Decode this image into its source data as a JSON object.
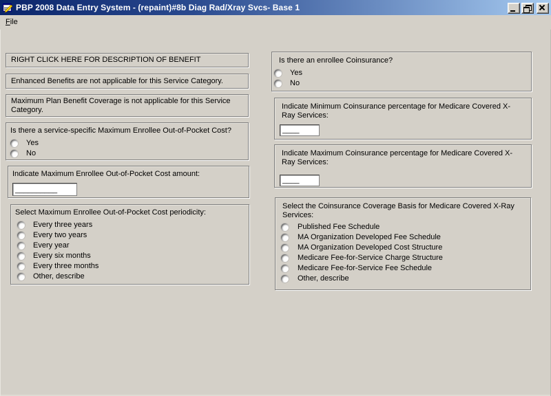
{
  "window": {
    "title": "PBP 2008 Data Entry System - (repaint)#8b Diag Rad/Xray Svcs- Base 1"
  },
  "menu": {
    "file_accelerator": "F",
    "file_rest": "ile"
  },
  "left": {
    "description_banner": "RIGHT CLICK HERE FOR DESCRIPTION OF BENEFIT",
    "enhanced_note": "Enhanced Benefits are not applicable for this Service Category.",
    "max_plan_note": "Maximum Plan Benefit Coverage is not applicable for this Service Category.",
    "oop_question": {
      "label": "Is there a service-specific Maximum Enrollee Out-of-Pocket Cost?",
      "options": [
        "Yes",
        "No"
      ]
    },
    "oop_amount": {
      "label": "Indicate Maximum Enrollee Out-of-Pocket Cost amount:",
      "value": "__________"
    },
    "oop_periodicity": {
      "label": "Select Maximum Enrollee Out-of-Pocket Cost periodicity:",
      "options": [
        "Every three years",
        "Every two years",
        "Every year",
        "Every six months",
        "Every three months",
        "Other, describe"
      ]
    }
  },
  "right": {
    "coinsurance_question": {
      "label": "Is there an enrollee Coinsurance?",
      "options": [
        "Yes",
        "No"
      ]
    },
    "min_coinsurance": {
      "label": "Indicate Minimum Coinsurance percentage for Medicare Covered X-Ray Services:",
      "value": "____"
    },
    "max_coinsurance": {
      "label": "Indicate Maximum Coinsurance percentage for Medicare Covered X-Ray Services:",
      "value": "____"
    },
    "coverage_basis": {
      "label": "Select the Coinsurance Coverage Basis for Medicare Covered X-Ray Services:",
      "options": [
        "Published Fee Schedule",
        "MA Organization Developed Fee Schedule",
        "MA Organization Developed Cost Structure",
        "Medicare Fee-for-Service Charge Structure",
        "Medicare Fee-for-Service Fee Schedule",
        "Other, describe"
      ]
    }
  },
  "colors": {
    "titlebar_start": "#0a246a",
    "titlebar_end": "#a6caf0",
    "background": "#d4d0c8",
    "box_border": "#808080",
    "highlight": "#ffffff"
  }
}
